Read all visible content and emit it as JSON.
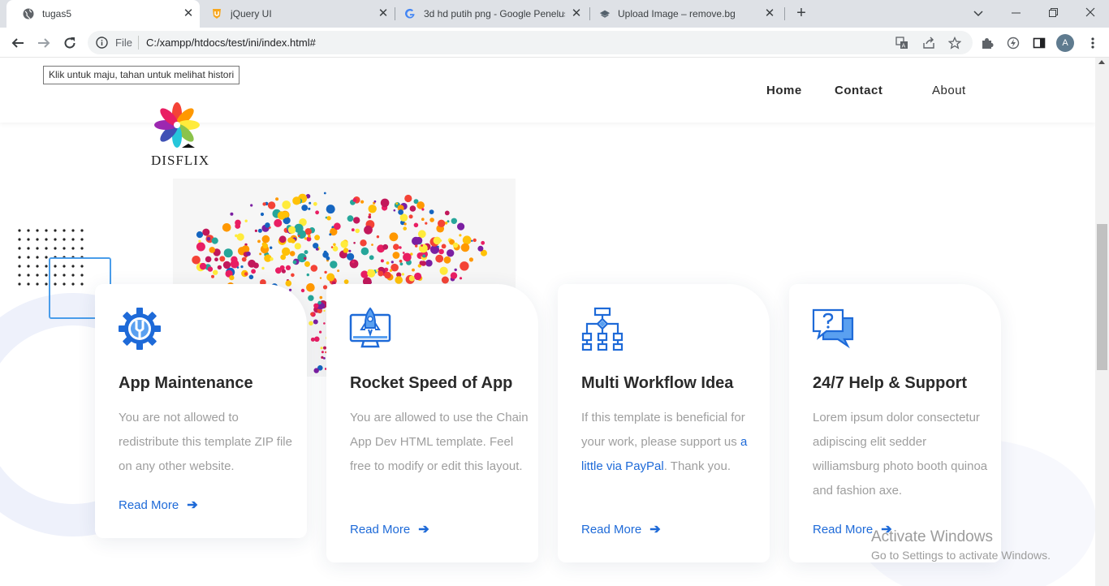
{
  "browser": {
    "tabs": [
      {
        "title": "tugas5",
        "icon": "globe-icon",
        "active": true
      },
      {
        "title": "jQuery UI",
        "icon": "jquery-shield-icon",
        "active": false
      },
      {
        "title": "3d hd putih png - Google Penelusur",
        "icon": "google-icon",
        "active": false
      },
      {
        "title": "Upload Image – remove.bg",
        "icon": "removebg-icon",
        "active": false
      }
    ],
    "address": {
      "scheme_label": "File",
      "url": "C:/xampp/htdocs/test/ini/index.html#"
    },
    "profile_initial": "A",
    "tooltip": "Klik untuk maju, tahan untuk melihat histori"
  },
  "site": {
    "logo_text": "DISFLIX",
    "nav": [
      "Home",
      "Contact",
      "About"
    ],
    "features": [
      {
        "title": "App Maintenance",
        "text": "You are not allowed to redistribute this template ZIP file on any other website.",
        "link_text": "",
        "text_after": "",
        "read_more": "Read More",
        "icon": "gear-wrench-icon"
      },
      {
        "title": "Rocket Speed of App",
        "text": "You are allowed to use the Chain App Dev HTML template. Feel free to modify or edit this layout.",
        "link_text": "",
        "text_after": "",
        "read_more": "Read More",
        "icon": "rocket-monitor-icon"
      },
      {
        "title": "Multi Workflow Idea",
        "text": "If this template is beneficial for your work, please support us ",
        "link_text": "a little via PayPal",
        "text_after": ". Thank you.",
        "read_more": "Read More",
        "icon": "workflow-icon"
      },
      {
        "title": "24/7 Help & Support",
        "text": "Lorem ipsum dolor consectetur adipiscing elit sedder williamsburg photo booth quinoa and fashion axe.",
        "link_text": "",
        "text_after": "",
        "read_more": "Read More",
        "icon": "help-chat-icon"
      }
    ]
  },
  "os_watermark": {
    "line1": "Activate Windows",
    "line2": "Go to Settings to activate Windows."
  },
  "colors": {
    "accent": "#1e6ad8",
    "icon_blue": "#1e6ad8",
    "heading": "#2a2a2a",
    "body_text": "#9e9e9e"
  }
}
